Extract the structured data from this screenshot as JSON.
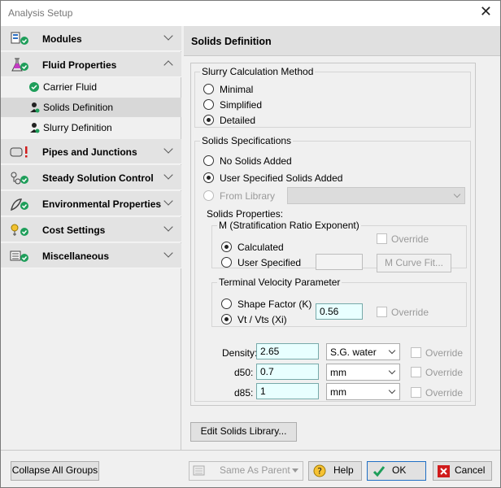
{
  "window": {
    "title": "Analysis Setup"
  },
  "sidebar": {
    "groups": [
      {
        "label": "Modules",
        "icon": "modules-icon"
      },
      {
        "label": "Fluid Properties",
        "icon": "flask-icon"
      },
      {
        "label": "Pipes and Junctions",
        "icon": "pipe-icon"
      },
      {
        "label": "Steady Solution Control",
        "icon": "solution-control-icon"
      },
      {
        "label": "Environmental Properties",
        "icon": "environmental-icon"
      },
      {
        "label": "Cost Settings",
        "icon": "cost-icon"
      },
      {
        "label": "Miscellaneous",
        "icon": "misc-icon"
      }
    ],
    "subitems": [
      {
        "label": "Carrier Fluid",
        "icon": "check-icon"
      },
      {
        "label": "Solids Definition",
        "icon": "solids-icon"
      },
      {
        "label": "Slurry Definition",
        "icon": "slurry-icon"
      }
    ],
    "collapse_label": "Collapse All Groups"
  },
  "panel": {
    "title": "Solids Definition",
    "method": {
      "legend": "Slurry Calculation Method",
      "options": [
        "Minimal",
        "Simplified",
        "Detailed"
      ],
      "selected": "Detailed"
    },
    "specs": {
      "legend": "Solids Specifications",
      "options": [
        "No Solids Added",
        "User Specified Solids Added",
        "From Library"
      ],
      "selected": "User Specified Solids Added",
      "props_label": "Solids Properties:",
      "m": {
        "legend": "M (Stratification Ratio Exponent)",
        "calculated": "Calculated",
        "user": "User Specified",
        "override": "Override",
        "curve_button": "M Curve Fit..."
      },
      "tv": {
        "legend": "Terminal Velocity Parameter",
        "shape": "Shape Factor (K)",
        "vt": "Vt / Vts (Xi)",
        "value": "0.56",
        "override": "Override"
      },
      "density": {
        "label": "Density:",
        "value": "2.65",
        "unit": "S.G. water",
        "override": "Override"
      },
      "d50": {
        "label": "d50:",
        "value": "0.7",
        "unit": "mm",
        "override": "Override"
      },
      "d85": {
        "label": "d85:",
        "value": "1",
        "unit": "mm",
        "override": "Override"
      }
    },
    "edit_library_button": "Edit Solids Library..."
  },
  "footer": {
    "same_as_parent": "Same As Parent",
    "help": "Help",
    "ok": "OK",
    "cancel": "Cancel"
  },
  "colors": {
    "accent_green": "#1e9e5a",
    "accent_red": "#d01b1b",
    "input_cyan": "#e8ffff"
  }
}
